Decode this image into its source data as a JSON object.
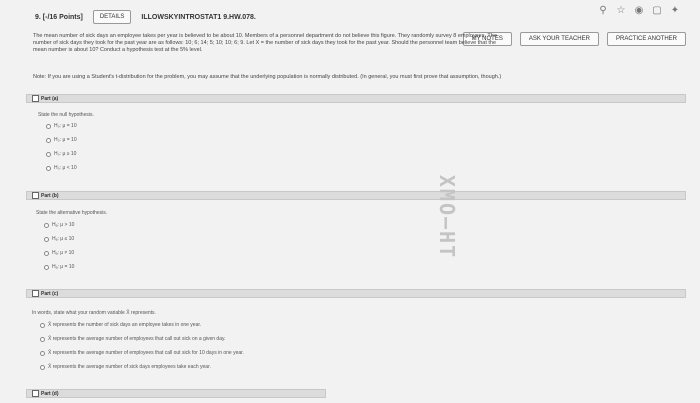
{
  "toolbar": {
    "question_number": "9. [-/16 Points]",
    "details_label": "DETAILS",
    "assignment_id": "ILLOWSKYINTROSTAT1 9.HW.078."
  },
  "header_buttons": {
    "my_notes": "MY NOTES",
    "ask_teacher": "ASK YOUR TEACHER",
    "practice_another": "PRACTICE ANOTHER"
  },
  "question": {
    "text": "The mean number of sick days an employee takes per year is believed to be about 10. Members of a personnel department do not believe this figure. They randomly survey 8 employees. The number of sick days they took for the past year are as follows: 10; 6; 14; 5; 10; 10; 6; 9. Let X = the number of sick days they took for the past year. Should the personnel team believe that the mean number is about 10? Conduct a hypothesis test at the 5% level.",
    "note": "Note: If you are using a Student's t-distribution for the problem, you may assume that the underlying population is normally distributed. (In general, you must first prove that assumption, though.)"
  },
  "parts": [
    {
      "label": "Part (a)",
      "prompt": "State the null hypothesis.",
      "options": [
        "H₀: μ = 10",
        "H₀: μ = 10",
        "H₀: μ ≥ 10",
        "H₀: μ < 10"
      ]
    },
    {
      "label": "Part (b)",
      "prompt": "State the alternative hypothesis.",
      "options": [
        "Hₐ: μ > 10",
        "Hₐ: μ ≤ 10",
        "Hₐ: μ ≠ 10",
        "Hₐ: μ = 10"
      ]
    },
    {
      "label": "Part (c)",
      "prompt": "In words, state what your random variable X̄ represents.",
      "options": [
        "X̄ represents the number of sick days an employee takes in one year.",
        "X̄ represents the average number of employees that call out sick on a given day.",
        "X̄ represents the average number of employees that call out sick for 10 days in one year.",
        "X̄ represents the average number of sick days employees take each year."
      ]
    },
    {
      "label": "Part (d)"
    }
  ],
  "watermark": "XMO—HT"
}
